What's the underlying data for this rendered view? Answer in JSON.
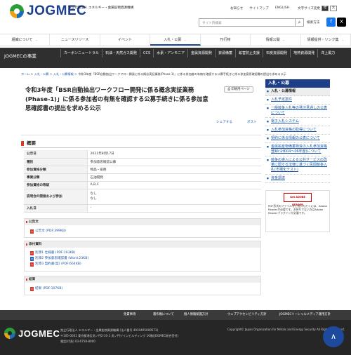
{
  "header": {
    "logo": "JOGMEC",
    "org_line1": "独立行政法人 エネルギー・金属鉱物資源機構",
    "org_line2": "",
    "links": [
      "お知らせ",
      "サイトマップ",
      "ENGLISH"
    ],
    "font_size_label": "文字サイズ変更",
    "font_sizes": [
      "標",
      "大"
    ],
    "search_placeholder": "サイト内検索",
    "search_how": "検索方法"
  },
  "mainnav": [
    {
      "label": "組織について"
    },
    {
      "label": "ニュースリリース"
    },
    {
      "label": "イベント"
    },
    {
      "label": "入札・公募"
    },
    {
      "label": "刊行物"
    },
    {
      "label": "情報公開"
    },
    {
      "label": "情報提供・リンク集"
    }
  ],
  "subnav": {
    "section": "JOGMECの事業",
    "items": [
      "カーボンニュートラル",
      "石油・天然ガス開発",
      "CCS",
      "水素・アンモニア",
      "金属資源開発",
      "資源備蓄",
      "鉱害防止支援",
      "石炭資源開発",
      "地熱資源開発",
      "洋上風力"
    ]
  },
  "breadcrumb": [
    "ホーム",
    "入札・公募",
    "入札・公募情報",
    "令和3年度「BSR自動抽出ワークフロー開発に係る概念実証業務(Phase-1)」に係る参加者の有無を確認する公募手続きに係る参加意思確認書の提出を求める公示"
  ],
  "page": {
    "title": "令和3年度「BSR自動抽出ワークフロー開発に係る概念実証業務(Phase-1)」に係る参加者の有無を確認する公募手続きに係る参加意思確認書の提出を求める公示",
    "print": "印刷用ページ",
    "share": "シェアする",
    "post": "ポスト"
  },
  "overview": {
    "heading": "概要",
    "rows": [
      {
        "k": "公示日",
        "v": "2021年8月17日"
      },
      {
        "k": "種別",
        "v": "参加意思確認公募"
      },
      {
        "k": "参加資格分類",
        "v": "物品・役務"
      },
      {
        "k": "事業分類",
        "v": "石油開発"
      },
      {
        "k": "参加資格の等級",
        "v": "A,B,C"
      },
      {
        "k": "説明会の開催および参加",
        "v": "なし\nなし"
      },
      {
        "k": "入札日",
        "v": "-"
      }
    ]
  },
  "docs": {
    "public_heading": "公告文",
    "public": [
      {
        "t": "公告文 (PDF:399KB)"
      }
    ],
    "attach_heading": "添付資料",
    "attach": [
      {
        "t": "別添1 仕様書 (PDF:193KB)",
        "type": "pdf"
      },
      {
        "t": "別添2 参加意思確認書 (Word:23KB)",
        "type": "word"
      },
      {
        "t": "別添3 契約書(案) (PDF:664KB)",
        "type": "pdf"
      }
    ],
    "result_heading": "結果",
    "result": [
      {
        "t": "結果 (PDF:107KB)"
      }
    ]
  },
  "side": {
    "head": "入札・公募",
    "items": [
      {
        "t": "入札・公募情報",
        "cat": true
      },
      {
        "t": "入札予定案件"
      },
      {
        "t": "一般競争入札等の発注見通しの公表について"
      },
      {
        "t": "電子入札システム"
      },
      {
        "t": "入札参加資格の取得について"
      },
      {
        "t": "契約に係る情報の公表について"
      },
      {
        "t": "金属鉱産物備蓄物資の入札参加資格登録(令和04〜06年度)について"
      },
      {
        "t": "競争の導入による公共サービスの改革に関する法律に基づく民間競争入札(市場化テスト)"
      },
      {
        "t": "資金調達"
      }
    ],
    "adobe_btn": "Get ADOBE READER",
    "adobe_text": "PDF形式のファイルをご覧いただくには、Adobe Readerが必要です。お持ちでない方はAdobe Readerプラグインが必要です。"
  },
  "footer_nav": [
    "免責事項",
    "著作権について",
    "個人情報保護方針",
    "ウェブアクセシビリティ方針",
    "JOGMECソーシャルメディア運用方針"
  ],
  "footer": {
    "logo": "JOGMEC",
    "addr1": "独立行政法人 エネルギー・金属鉱物資源機構 (法人番号 4010405009573)",
    "addr2": "〒105-0001 東京都港区虎ノ門2-10-1 虎ノ門ツインビルディング 16階(JOGMEC総合受付)",
    "addr3": "電話(代表) 03-6758-8000",
    "copy": "Copyright© Japan Organization for Metals and Energy Security All Rights Reserved."
  },
  "colors": {
    "brand": "#1b3f8b",
    "accent": "#d93a2f",
    "dark": "#2f2f2f"
  }
}
